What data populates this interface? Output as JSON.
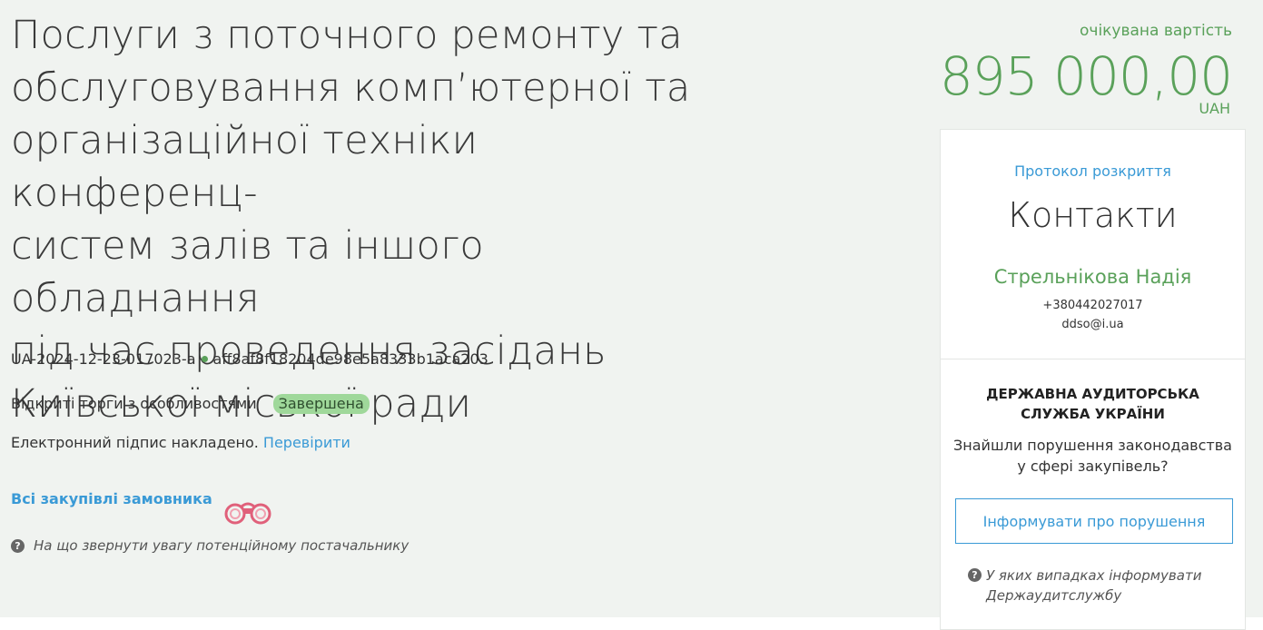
{
  "tender": {
    "title": "Послуги з поточного ремонту та обслуговування комп’ютерної та організаційної техніки конференц-систем залів та іншого обладнання під час проведення засідань Київської міської ради",
    "title_lines": [
      "Послуги з поточного ремонту та",
      "обслуговування комп’ютерної та",
      "організаційної техніки конференц-",
      "систем залів та іншого обладнання",
      "під час проведення засідань",
      "Київської міської ради"
    ],
    "tender_id": "UA-2024-12-23-017023-a",
    "hash_id": "aff8af8f18204de98e5a8333b1aca203",
    "procedure_type": "Відкриті торги з особливостями",
    "status": "Завершена",
    "signature_text": "Електронний підпис накладено.",
    "verify_link": "Перевірити",
    "all_purchases_link": "Всі закупівлі замовника",
    "supplier_hint": "На що звернути увагу потенційному постачальнику"
  },
  "price": {
    "label": "очікувана вартість",
    "amount": "895 000,00",
    "currency": "UAH"
  },
  "contacts": {
    "protocol_link": "Протокол розкриття",
    "title": "Контакти",
    "name": "Стрельнікова Надія",
    "phone": "+380442027017",
    "email": "ddso@i.ua"
  },
  "audit": {
    "title": "ДЕРЖАВНА АУДИТОРСЬКА СЛУЖБА УКРАЇНИ",
    "question": "Знайшли порушення законодавства у сфері закупівель?",
    "button": "Інформувати про порушення",
    "hint": "У яких випадках інформувати Держаудитслужбу"
  },
  "colors": {
    "background": "#f0f3f0",
    "accent_green": "#5aa15a",
    "link_blue": "#3a9ad6",
    "badge_green": "#9fd89a",
    "binoculars": "#e0607a"
  },
  "icons": {
    "status_dot": "green-dot",
    "all_purchases": "binoculars-icon",
    "hint": "question-circle-icon"
  }
}
